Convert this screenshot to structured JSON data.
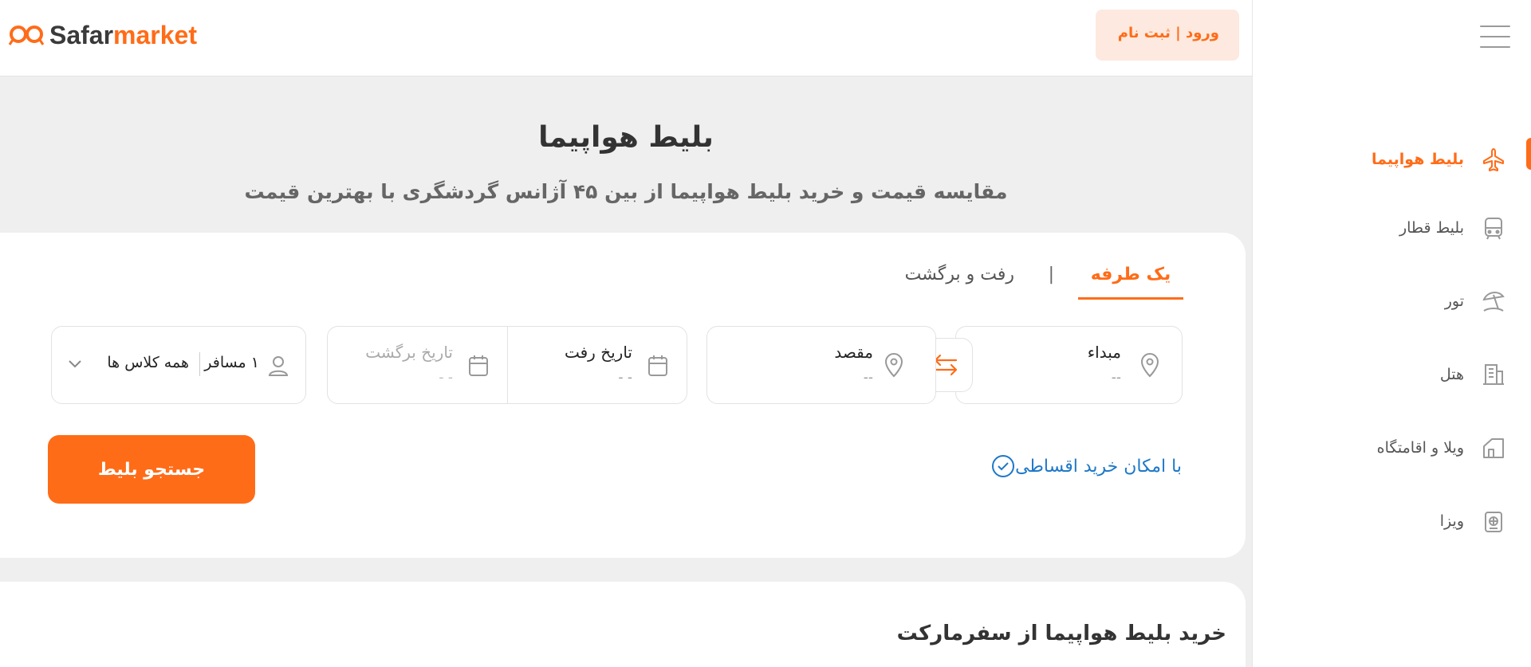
{
  "header": {
    "logo_part1": "Safar",
    "logo_part2": "market",
    "login_label": "ورود | ثبت نام"
  },
  "sidebar": {
    "items": [
      {
        "label": "بلیط هواپیما",
        "icon": "airplane-icon",
        "active": true
      },
      {
        "label": "بلیط قطار",
        "icon": "train-icon",
        "active": false
      },
      {
        "label": "تور",
        "icon": "beach-umbrella-icon",
        "active": false
      },
      {
        "label": "هتل",
        "icon": "hotel-building-icon",
        "active": false
      },
      {
        "label": "ویلا و اقامتگاه",
        "icon": "villa-icon",
        "active": false
      },
      {
        "label": "ویزا",
        "icon": "passport-icon",
        "active": false
      }
    ]
  },
  "hero": {
    "title": "بلیط هواپیما",
    "subtitle": "مقایسه قیمت و خرید بلیط هواپیما از بین ۴۵ آژانس گردشگری با بهترین قیمت"
  },
  "search": {
    "tabs": {
      "one_way": "یک طرفه",
      "separator": "|",
      "round_trip": "رفت و برگشت"
    },
    "origin": {
      "label": "مبداء",
      "value": "--"
    },
    "destination": {
      "label": "مقصد",
      "value": "--"
    },
    "departure": {
      "label": "تاریخ رفت",
      "value": "- -"
    },
    "return": {
      "label": "تاریخ برگشت",
      "value": "- -"
    },
    "passengers": {
      "count_label": "۱ مسافر",
      "class_label": "همه کلاس ها"
    },
    "installment_label": "با امکان خرید اقساطی",
    "search_button": "جستجو بلیط"
  },
  "section2": {
    "title": "خرید بلیط هواپیما از سفرمارکت"
  },
  "colors": {
    "accent": "#ff6c18",
    "link": "#1e78c8"
  }
}
